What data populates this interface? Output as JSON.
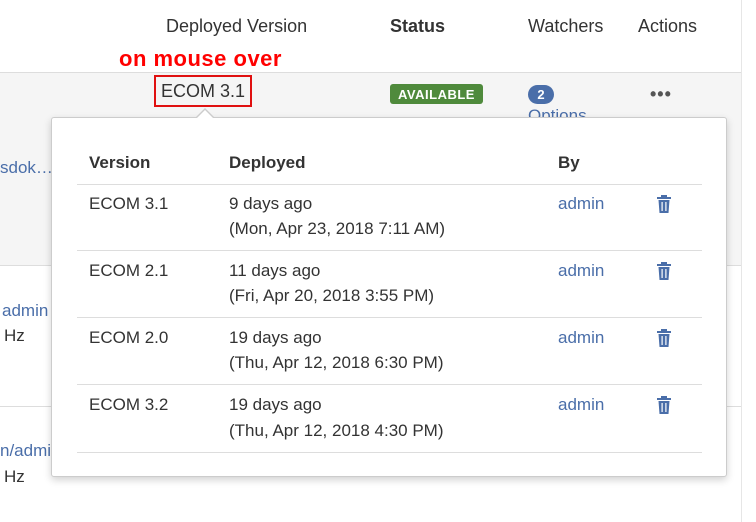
{
  "table": {
    "headers": {
      "deployed_version": "Deployed Version",
      "status": "Status",
      "watchers": "Watchers",
      "actions": "Actions"
    },
    "row": {
      "deployed_version": "ECOM 3.1",
      "status_badge": "AVAILABLE",
      "watchers_count": "2",
      "watchers_link": "Options",
      "actions_icon": "more-horizontal-icon"
    },
    "background_fragments": [
      "sdok…",
      "admin",
      "Hz",
      "n/admin",
      "Hz"
    ]
  },
  "annotation": "on mouse over",
  "popup": {
    "headers": {
      "version": "Version",
      "deployed": "Deployed",
      "by": "By"
    },
    "rows": [
      {
        "version": "ECOM 3.1",
        "relative": "9 days ago",
        "absolute": "(Mon, Apr 23, 2018 7:11 AM)",
        "by": "admin"
      },
      {
        "version": "ECOM 2.1",
        "relative": "11 days ago",
        "absolute": "(Fri, Apr 20, 2018 3:55 PM)",
        "by": "admin"
      },
      {
        "version": "ECOM 2.0",
        "relative": "19 days ago",
        "absolute": "(Thu, Apr 12, 2018 6:30 PM)",
        "by": "admin"
      },
      {
        "version": "ECOM 3.2",
        "relative": "19 days ago",
        "absolute": "(Thu, Apr 12, 2018 4:30 PM)",
        "by": "admin"
      }
    ],
    "delete_icon": "trash-icon"
  },
  "colors": {
    "link": "#4a6ea9",
    "available_badge": "#4f8a3c",
    "annotation": "#ff0000",
    "highlight_border": "#e01010"
  }
}
